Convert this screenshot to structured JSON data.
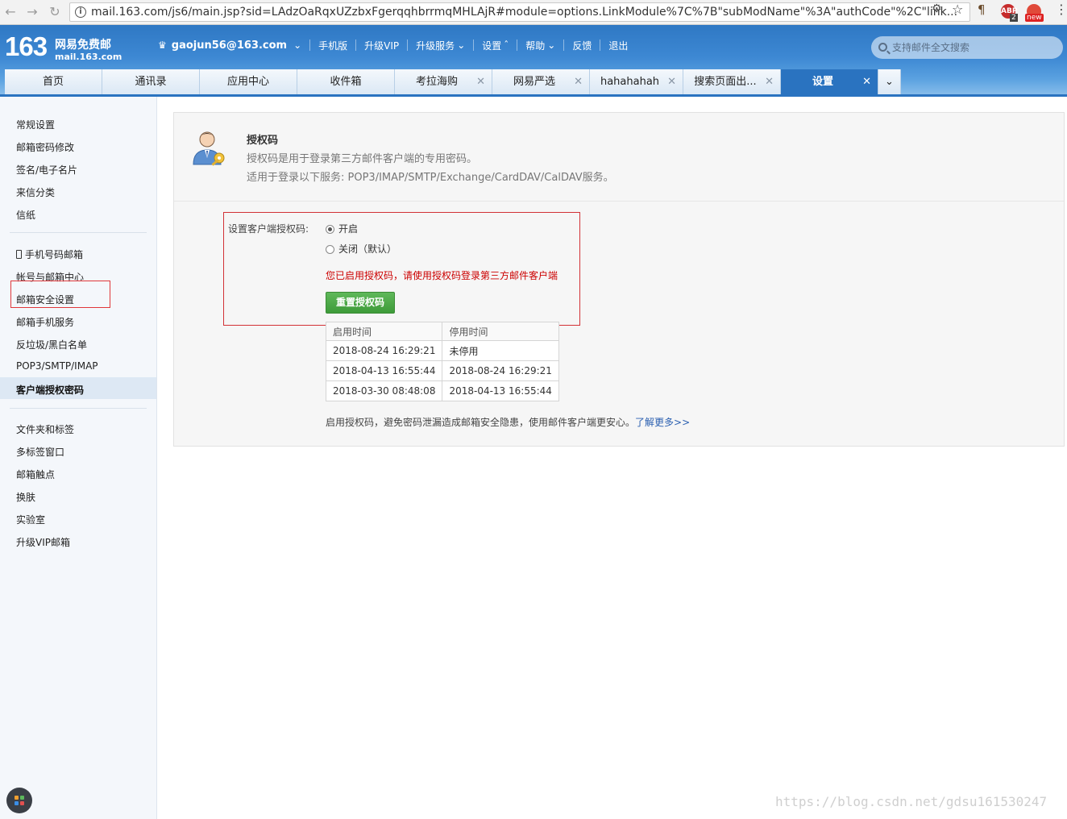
{
  "browser": {
    "url": "mail.163.com/js6/main.jsp?sid=LAdzOaRqxUZzbxFgerqqhbrrmqMHLAjR#module=options.LinkModule%7C%7B\"subModName\"%3A\"authCode\"%2C\"link...",
    "ext_abp_badge": "2",
    "ext_new_badge": "new",
    "ext_abp_label": "ABP"
  },
  "header": {
    "logo_number": "163",
    "logo_text": "网易免费邮",
    "logo_domain": "mail.163.com",
    "user": "gaojun56@163.com",
    "menu": [
      "手机版",
      "升级VIP",
      "升级服务",
      "设置",
      "帮助",
      "反馈",
      "退出"
    ],
    "search_placeholder": "支持邮件全文搜索"
  },
  "tabs": [
    {
      "label": "首页",
      "closable": false,
      "active": false
    },
    {
      "label": "通讯录",
      "closable": false,
      "active": false
    },
    {
      "label": "应用中心",
      "closable": false,
      "active": false
    },
    {
      "label": "收件箱",
      "closable": false,
      "active": false
    },
    {
      "label": "考拉海购",
      "closable": true,
      "active": false
    },
    {
      "label": "网易严选",
      "closable": true,
      "active": false
    },
    {
      "label": "hahahahah",
      "closable": true,
      "active": false
    },
    {
      "label": "搜索页面出...",
      "closable": true,
      "active": false
    },
    {
      "label": "设置",
      "closable": true,
      "active": true
    }
  ],
  "sidebar": {
    "group1": [
      "常规设置",
      "邮箱密码修改",
      "签名/电子名片",
      "来信分类",
      "信纸"
    ],
    "group2": [
      "手机号码邮箱",
      "帐号与邮箱中心",
      "邮箱安全设置",
      "邮箱手机服务",
      "反垃圾/黑白名单",
      "POP3/SMTP/IMAP",
      "客户端授权密码"
    ],
    "group3": [
      "文件夹和标签",
      "多标签窗口",
      "邮箱触点",
      "换肤",
      "实验室",
      "升级VIP邮箱"
    ],
    "active": "客户端授权密码"
  },
  "content": {
    "title": "授权码",
    "desc1": "授权码是用于登录第三方邮件客户端的专用密码。",
    "desc2": "适用于登录以下服务: POP3/IMAP/SMTP/Exchange/CardDAV/CalDAV服务。",
    "field_label": "设置客户端授权码:",
    "option_on": "开启",
    "option_off": "关闭（默认）",
    "selected": "开启",
    "warning": "您已启用授权码，请使用授权码登录第三方邮件客户端",
    "reset_button": "重置授权码",
    "table_headers": [
      "启用时间",
      "停用时间"
    ],
    "table_rows": [
      [
        "2018-08-24 16:29:21",
        "未停用"
      ],
      [
        "2018-04-13 16:55:44",
        "2018-08-24 16:29:21"
      ],
      [
        "2018-03-30 08:48:08",
        "2018-04-13 16:55:44"
      ]
    ],
    "note": "启用授权码，避免密码泄漏造成邮箱安全隐患，使用邮件客户端更安心。",
    "note_link": "了解更多>>"
  },
  "watermark": "https://blog.csdn.net/gdsu161530247",
  "colors": {
    "brand_blue": "#2a73c0",
    "warning_red": "#cc0000",
    "button_green": "#4aa845",
    "highlight_red": "#e0373a"
  }
}
